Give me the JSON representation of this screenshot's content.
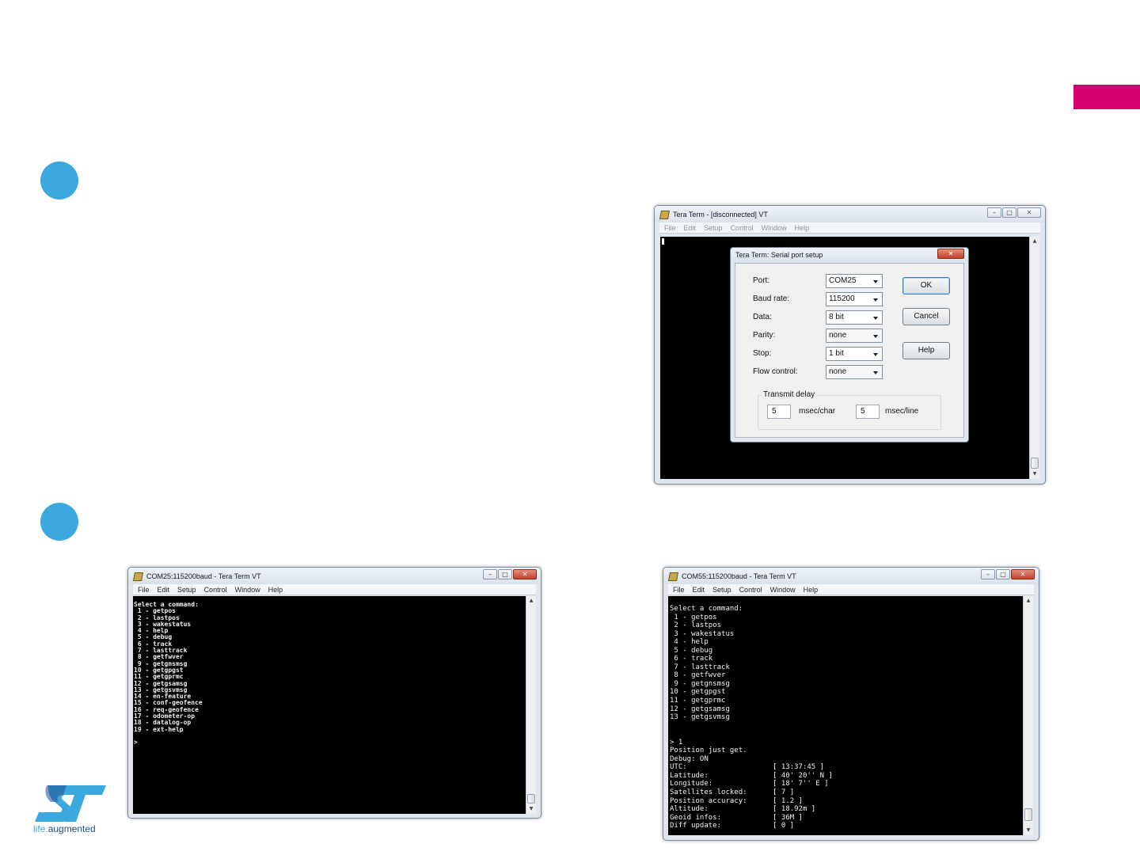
{
  "brand": {
    "tagline_prefix": "life.",
    "tagline_suffix": "augmented",
    "accent": "#d4006f",
    "bullet_color": "#3ba8e0"
  },
  "window_top": {
    "title": "Tera Term - [disconnected] VT",
    "menu": [
      "File",
      "Edit",
      "Setup",
      "Control",
      "Window",
      "Help"
    ],
    "dialog": {
      "title": "Tera Term: Serial port setup",
      "fields": [
        {
          "label": "Port:",
          "value": "COM25"
        },
        {
          "label": "Baud rate:",
          "value": "115200"
        },
        {
          "label": "Data:",
          "value": "8 bit"
        },
        {
          "label": "Parity:",
          "value": "none"
        },
        {
          "label": "Stop:",
          "value": "1 bit"
        },
        {
          "label": "Flow control:",
          "value": "none"
        }
      ],
      "buttons": {
        "ok": "OK",
        "cancel": "Cancel",
        "help": "Help"
      },
      "transmit_delay": {
        "label": "Transmit delay",
        "char_value": "5",
        "char_unit": "msec/char",
        "line_value": "5",
        "line_unit": "msec/line"
      }
    }
  },
  "window_left": {
    "title": "COM25:115200baud - Tera Term VT",
    "menu": [
      "File",
      "Edit",
      "Setup",
      "Control",
      "Window",
      "Help"
    ],
    "terminal": "Select a command:\n 1 - getpos\n 2 - lastpos\n 3 - wakestatus\n 4 - help\n 5 - debug\n 6 - track\n 7 - lasttrack\n 8 - getfwver\n 9 - getgnsmsg\n10 - getgpgst\n11 - getgprmc\n12 - getgsamsg\n13 - getgsvmsg\n14 - en-feature\n15 - conf-geofence\n16 - req-geofence\n17 - odometer-op\n18 - datalog-op\n19 - ext-help\n\n>"
  },
  "window_right": {
    "title": "COM55:115200baud - Tera Term VT",
    "menu": [
      "File",
      "Edit",
      "Setup",
      "Control",
      "Window",
      "Help"
    ],
    "terminal": "Select a command:\n 1 - getpos\n 2 - lastpos\n 3 - wakestatus\n 4 - help\n 5 - debug\n 6 - track\n 7 - lasttrack\n 8 - getfwver\n 9 - getgnsmsg\n10 - getgpgst\n11 - getgprmc\n12 - getgsamsg\n13 - getgsvmsg\n\n\n> 1\nPosition just get.\nDebug: ON\nUTC:                    [ 13:37:45 ]\nLatitude:               [ 40' 20'' N ]\nLongitude:              [ 18' 7'' E ]\nSatellites locked:      [ 7 ]\nPosition accuracy:      [ 1.2 ]\nAltitude:               [ 18.92m ]\nGeoid infos:            [ 36M ]\nDiff update:            [ 0 ]"
  }
}
